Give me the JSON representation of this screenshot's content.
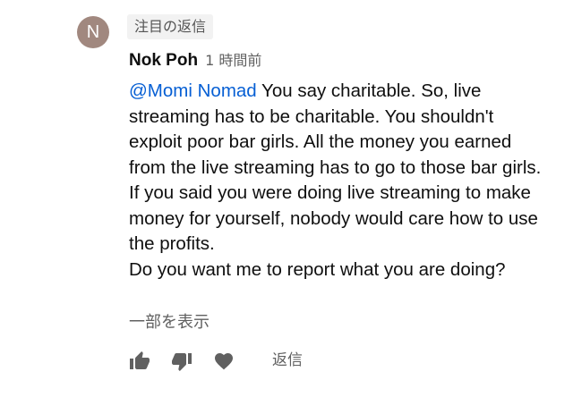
{
  "comment": {
    "avatar_letter": "N",
    "avatar_color": "#a1887f",
    "pinned_badge": "注目の返信",
    "author": "Nok Poh",
    "timestamp": "1 時間前",
    "mention": "@Momi Nomad",
    "paragraphs": [
      "You say charitable. So, live streaming has to be charitable. You shouldn't exploit poor bar girls. All the money you earned from the live streaming has to go to those bar girls.",
      "If you said you were doing live streaming to make money for yourself, nobody would care how to use the profits.",
      "Do you want me to report what you are doing?"
    ],
    "read_more": "一部を表示"
  },
  "actions": {
    "like_icon": "thumbs-up-icon",
    "dislike_icon": "thumbs-down-icon",
    "heart_icon": "heart-icon",
    "reply_label": "返信"
  },
  "colors": {
    "mention": "#065fd4",
    "secondary_text": "#606060",
    "icon": "#606060"
  }
}
